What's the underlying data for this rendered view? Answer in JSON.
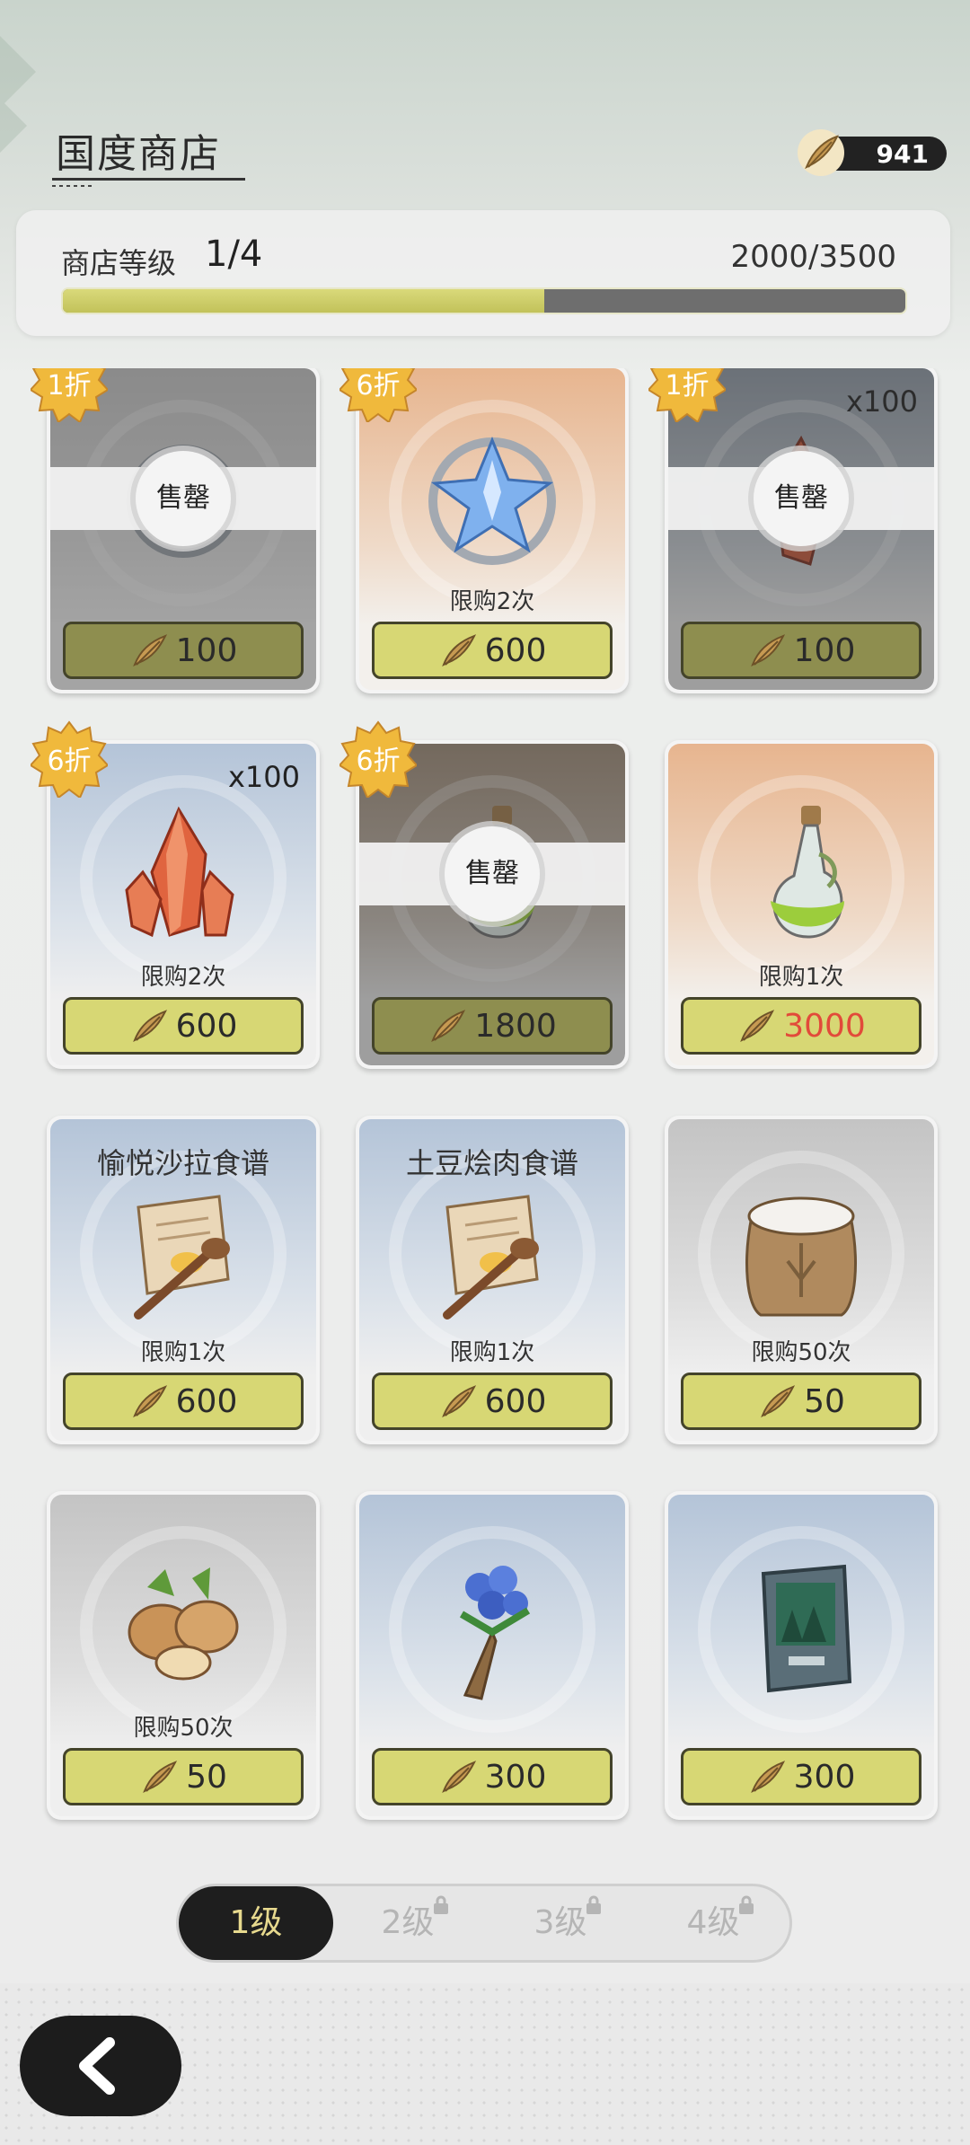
{
  "header": {
    "title": "国度商店",
    "currency_value": "941"
  },
  "level": {
    "label": "商店等级",
    "value": "1/4",
    "progress_text": "2000/3500",
    "progress_fraction": 0.571
  },
  "items": [
    {
      "name": "",
      "qty": "",
      "limit": "",
      "price": "100",
      "price_red": false,
      "sold_out": true,
      "sold_label": "售罄",
      "discount": "1折",
      "bg": "gray",
      "art": "crystal-frame"
    },
    {
      "name": "",
      "qty": "",
      "limit": "限购2次",
      "price": "600",
      "price_red": false,
      "sold_out": false,
      "sold_label": "",
      "discount": "6折",
      "bg": "orange",
      "art": "blue-crystal"
    },
    {
      "name": "",
      "qty": "x100",
      "limit": "",
      "price": "100",
      "price_red": false,
      "sold_out": true,
      "sold_label": "售罄",
      "discount": "1折",
      "bg": "slate",
      "art": "red-shard"
    },
    {
      "name": "",
      "qty": "x100",
      "limit": "限购2次",
      "price": "600",
      "price_red": false,
      "sold_out": false,
      "sold_label": "",
      "discount": "6折",
      "bg": "blue",
      "art": "red-crystal"
    },
    {
      "name": "",
      "qty": "",
      "limit": "",
      "price": "1800",
      "price_red": true,
      "sold_out": true,
      "sold_label": "售罄",
      "discount": "6折",
      "bg": "brown",
      "art": "potion"
    },
    {
      "name": "",
      "qty": "",
      "limit": "限购1次",
      "price": "3000",
      "price_red": true,
      "sold_out": false,
      "sold_label": "",
      "discount": "",
      "bg": "orange",
      "art": "potion"
    },
    {
      "name": "愉悦沙拉食谱",
      "qty": "",
      "limit": "限购1次",
      "price": "600",
      "price_red": false,
      "sold_out": false,
      "sold_label": "",
      "discount": "",
      "bg": "blue",
      "art": "recipe"
    },
    {
      "name": "土豆烩肉食谱",
      "qty": "",
      "limit": "限购1次",
      "price": "600",
      "price_red": false,
      "sold_out": false,
      "sold_label": "",
      "discount": "",
      "bg": "blue",
      "art": "recipe"
    },
    {
      "name": "",
      "qty": "",
      "limit": "限购50次",
      "price": "50",
      "price_red": false,
      "sold_out": false,
      "sold_label": "",
      "discount": "",
      "bg": "gray",
      "art": "flour"
    },
    {
      "name": "",
      "qty": "",
      "limit": "限购50次",
      "price": "50",
      "price_red": false,
      "sold_out": false,
      "sold_label": "",
      "discount": "",
      "bg": "gray",
      "art": "potatoes"
    },
    {
      "name": "",
      "qty": "",
      "limit": "",
      "price": "300",
      "price_red": false,
      "sold_out": false,
      "sold_label": "",
      "discount": "",
      "bg": "blue",
      "art": "bouquet"
    },
    {
      "name": "",
      "qty": "",
      "limit": "",
      "price": "300",
      "price_red": false,
      "sold_out": false,
      "sold_label": "",
      "discount": "",
      "bg": "blue",
      "art": "book"
    }
  ],
  "tabs": [
    {
      "label": "1级",
      "active": true,
      "locked": false
    },
    {
      "label": "2级",
      "active": false,
      "locked": true
    },
    {
      "label": "3级",
      "active": false,
      "locked": true
    },
    {
      "label": "4级",
      "active": false,
      "locked": true
    }
  ],
  "colors": {
    "accent": "#d7d774",
    "dark": "#1e1e1e",
    "price_red": "#e24a3a"
  }
}
